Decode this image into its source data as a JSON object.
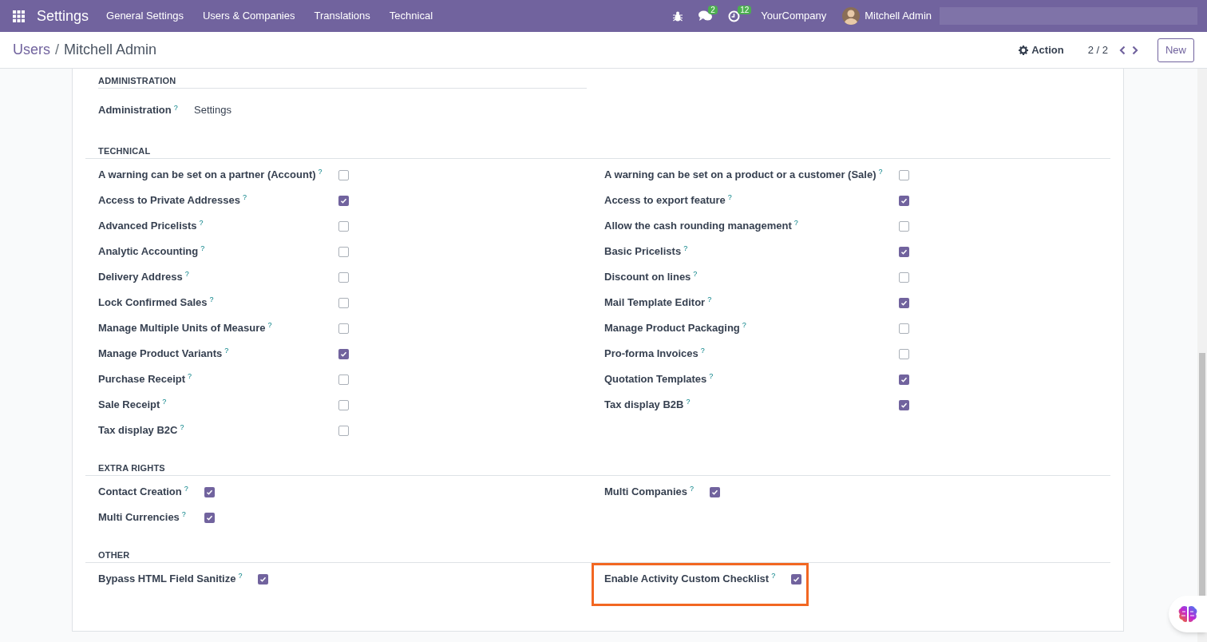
{
  "navbar": {
    "app": "Settings",
    "menus": [
      "General Settings",
      "Users & Companies",
      "Translations",
      "Technical"
    ],
    "messages_count": "2",
    "activities_count": "12",
    "company": "YourCompany",
    "user": "Mitchell Admin"
  },
  "breadcrumb": {
    "parent": "Users",
    "separator": "/",
    "current": "Mitchell Admin"
  },
  "control_panel": {
    "action": "Action",
    "pager": "2 / 2",
    "new_button": "New"
  },
  "sections": [
    {
      "title": "ADMINISTRATION",
      "kind": "selection",
      "fields": [
        {
          "label": "Administration",
          "help": "?",
          "value": "Settings"
        }
      ]
    },
    {
      "title": "TECHNICAL",
      "kind": "checkboxes",
      "columns": [
        [
          {
            "label": "A warning can be set on a partner (Account)",
            "help": "?",
            "checked": false
          },
          {
            "label": "Access to Private Addresses",
            "help": "?",
            "checked": true
          },
          {
            "label": "Advanced Pricelists",
            "help": "?",
            "checked": false
          },
          {
            "label": "Analytic Accounting",
            "help": "?",
            "checked": false
          },
          {
            "label": "Delivery Address",
            "help": "?",
            "checked": false
          },
          {
            "label": "Lock Confirmed Sales",
            "help": "?",
            "checked": false
          },
          {
            "label": "Manage Multiple Units of Measure",
            "help": "?",
            "checked": false
          },
          {
            "label": "Manage Product Variants",
            "help": "?",
            "checked": true
          },
          {
            "label": "Purchase Receipt",
            "help": "?",
            "checked": false
          },
          {
            "label": "Sale Receipt",
            "help": "?",
            "checked": false
          },
          {
            "label": "Tax display B2C",
            "help": "?",
            "checked": false
          }
        ],
        [
          {
            "label": "A warning can be set on a product or a customer (Sale)",
            "help": "?",
            "checked": false
          },
          {
            "label": "Access to export feature",
            "help": "?",
            "checked": true
          },
          {
            "label": "Allow the cash rounding management",
            "help": "?",
            "checked": false
          },
          {
            "label": "Basic Pricelists",
            "help": "?",
            "checked": true
          },
          {
            "label": "Discount on lines",
            "help": "?",
            "checked": false
          },
          {
            "label": "Mail Template Editor",
            "help": "?",
            "checked": true
          },
          {
            "label": "Manage Product Packaging",
            "help": "?",
            "checked": false
          },
          {
            "label": "Pro-forma Invoices",
            "help": "?",
            "checked": false
          },
          {
            "label": "Quotation Templates",
            "help": "?",
            "checked": true
          },
          {
            "label": "Tax display B2B",
            "help": "?",
            "checked": true
          }
        ]
      ]
    },
    {
      "title": "EXTRA RIGHTS",
      "kind": "checkboxes",
      "columns": [
        [
          {
            "label": "Contact Creation",
            "help": "?",
            "checked": true
          },
          {
            "label": "Multi Currencies",
            "help": "?",
            "checked": true
          }
        ],
        [
          {
            "label": "Multi Companies",
            "help": "?",
            "checked": true
          }
        ]
      ]
    },
    {
      "title": "OTHER",
      "kind": "checkboxes",
      "columns": [
        [
          {
            "label": "Bypass HTML Field Sanitize",
            "help": "?",
            "checked": true
          }
        ],
        [
          {
            "label": "Enable Activity Custom Checklist",
            "help": "?",
            "checked": true,
            "highlighted": true
          }
        ]
      ]
    }
  ]
}
